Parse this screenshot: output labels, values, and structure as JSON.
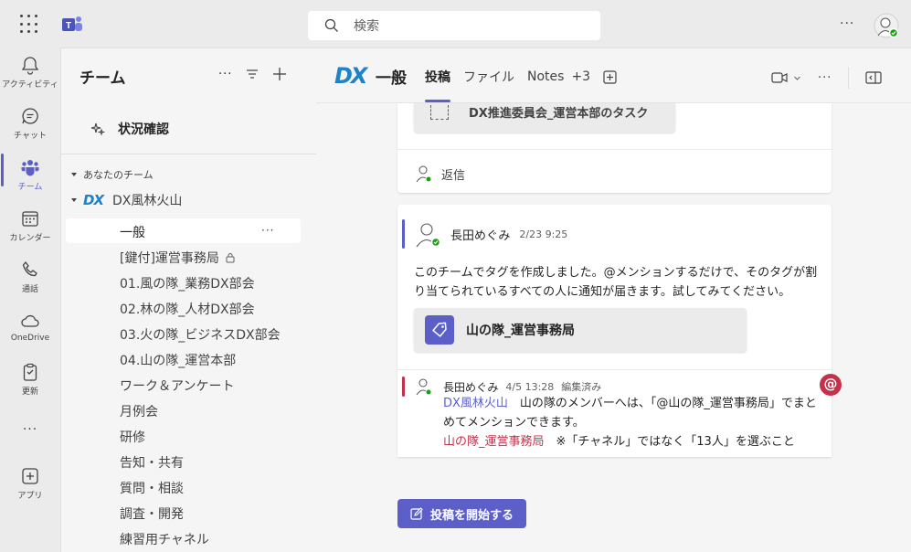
{
  "top": {
    "search_placeholder": "検索",
    "more": "···"
  },
  "rail": {
    "items": [
      {
        "label": "アクティビティ",
        "icon": "bell-icon"
      },
      {
        "label": "チャット",
        "icon": "chat-icon"
      },
      {
        "label": "チーム",
        "icon": "teams-icon"
      },
      {
        "label": "カレンダー",
        "icon": "calendar-icon"
      },
      {
        "label": "通話",
        "icon": "phone-icon"
      },
      {
        "label": "OneDrive",
        "icon": "cloud-icon"
      },
      {
        "label": "更新",
        "icon": "clipboard-icon"
      },
      {
        "label": "···",
        "icon": "more-icon"
      },
      {
        "label": "アプリ",
        "icon": "apps-icon"
      }
    ],
    "active_color": "#5b5fc7"
  },
  "panel": {
    "title": "チーム",
    "more": "···",
    "status_check": "状況確認",
    "your_teams": "あなたのチーム",
    "team_logo": "DX",
    "team_name": "DX風林火山",
    "channels": [
      "一般",
      "[鍵付]運営事務局",
      "01.風の隊_業務DX部会",
      "02.林の隊_人材DX部会",
      "03.火の隊_ビジネスDX部会",
      "04.山の隊_運営本部",
      "ワーク＆アンケート",
      "月例会",
      "研修",
      "告知・共有",
      "質問・相談",
      "調査・開発",
      "練習用チャネル"
    ],
    "channel_more": "···"
  },
  "header": {
    "logo": "DX",
    "title": "一般",
    "tabs": [
      "投稿",
      "ファイル",
      "Notes",
      "+3"
    ],
    "more": "···"
  },
  "post1": {
    "task_title": "DX推進委員会_運営本部のタスク",
    "reply": "返信"
  },
  "post2": {
    "author": "長田めぐみ",
    "time": "2/23 9:25",
    "body": "このチームでタグを作成しました。@メンションするだけで、そのタグが割り当てられているすべての人に通知が届きます。試してみてください。",
    "tag_name": "山の隊_運営事務局",
    "reply_author": "長田めぐみ",
    "reply_time": "4/5 13:28",
    "reply_edited": "編集済み",
    "reply_mention1": "DX風林火山",
    "reply_text1": "　山の隊のメンバーへは、「@山の隊_運営事務局」でまとめてメンションできます。",
    "reply_mention2": "山の隊_運営事務局",
    "reply_text2": "　※「チャネル」ではなく「13人」を選ぶこと",
    "at_badge": "@"
  },
  "compose": {
    "start_post": "投稿を開始する"
  },
  "colors": {
    "accent": "#5b5fc7",
    "dx_blue": "#1e82c8",
    "mention_red": "#c4314b"
  }
}
